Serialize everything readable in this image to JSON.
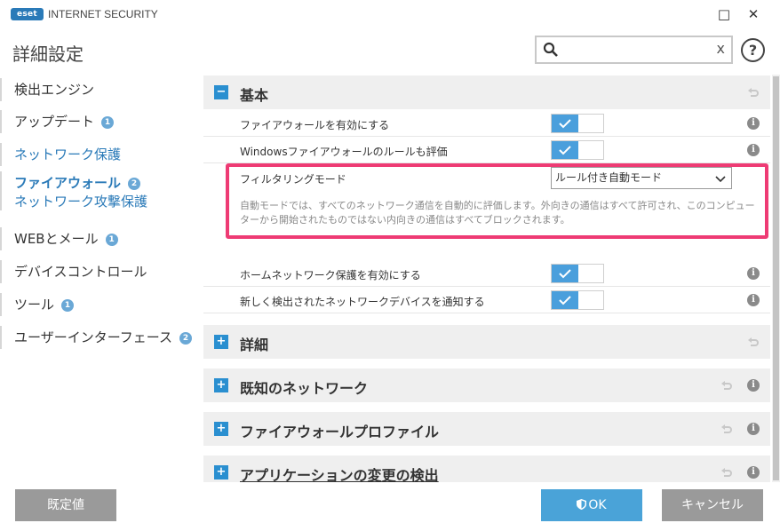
{
  "window": {
    "logo_text": "eset",
    "app_title": "INTERNET SECURITY",
    "minimize": "□",
    "close": "✕"
  },
  "header": {
    "page_title": "詳細設定",
    "search_value": "",
    "search_clear": "x",
    "help": "?"
  },
  "sidebar": {
    "items": [
      {
        "label": "検出エンジン"
      },
      {
        "label": "アップデート",
        "badge": "1"
      },
      {
        "label": "ネットワーク保護"
      },
      {
        "label": "ファイアウォール",
        "badge": "2"
      },
      {
        "label": "ネットワーク攻撃保護"
      },
      {
        "label": "WEBとメール",
        "badge": "1"
      },
      {
        "label": "デバイスコントロール"
      },
      {
        "label": "ツール",
        "badge": "1"
      },
      {
        "label": "ユーザーインターフェース",
        "badge": "2"
      }
    ]
  },
  "main": {
    "sections": [
      {
        "title": "基本",
        "expanded": true,
        "symbol": "−"
      },
      {
        "title": "詳細",
        "symbol": "+"
      },
      {
        "title": "既知のネットワーク",
        "symbol": "+"
      },
      {
        "title": "ファイアウォールプロファイル",
        "symbol": "+"
      },
      {
        "title": "アプリケーションの変更の検出",
        "symbol": "+"
      }
    ],
    "rows": [
      {
        "label": "ファイアウォールを有効にする",
        "enabled": true
      },
      {
        "label": "Windowsファイアウォールのルールも評価",
        "enabled": true
      },
      {
        "label": "フィルタリングモード",
        "value": "ルール付き自動モード"
      },
      {
        "label": "ホームネットワーク保護を有効にする",
        "enabled": true
      },
      {
        "label": "新しく検出されたネットワークデバイスを通知する",
        "enabled": true
      }
    ],
    "filter_description": "自動モードでは、すべてのネットワーク通信を自動的に評価します。外向きの通信はすべて許可され、このコンピューターから開始されたものではない内向きの通信はすべてブロックされます。",
    "info_glyph": "i"
  },
  "footer": {
    "default_label": "既定値",
    "ok_label": "OK",
    "cancel_label": "キャンセル"
  },
  "colors": {
    "accent": "#2a7ab8",
    "toggle_on": "#4a9fdc",
    "highlight": "#ee3b74",
    "ok_button": "#4aa3d8",
    "gray_button": "#9a9a9a"
  }
}
